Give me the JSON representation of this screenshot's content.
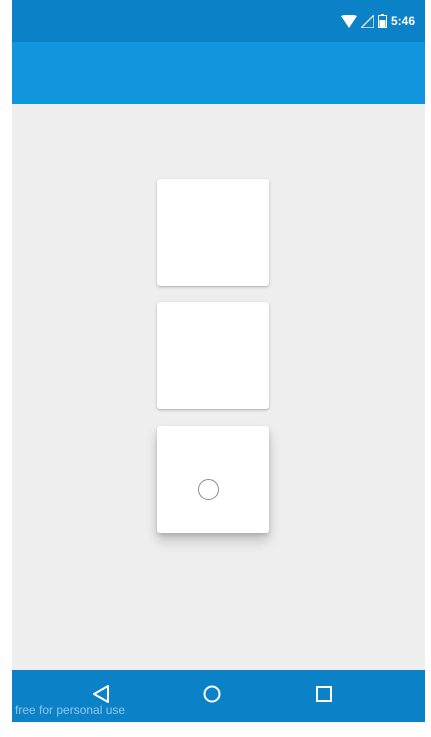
{
  "status_bar": {
    "time": "5:46",
    "icons": [
      "wifi-icon",
      "signal-icon",
      "battery-icon"
    ]
  },
  "app_bar": {
    "title": ""
  },
  "cards": [
    {
      "state": "resting"
    },
    {
      "state": "resting"
    },
    {
      "state": "pressed"
    }
  ],
  "nav_bar": {
    "buttons": [
      "back-icon",
      "home-icon",
      "recents-icon"
    ]
  },
  "watermark": "free for personal use",
  "colors": {
    "status_bar": "#0b82c8",
    "app_bar": "#1195dc",
    "background": "#eeeeee",
    "card": "#ffffff",
    "nav_bar": "#0b82c8"
  }
}
